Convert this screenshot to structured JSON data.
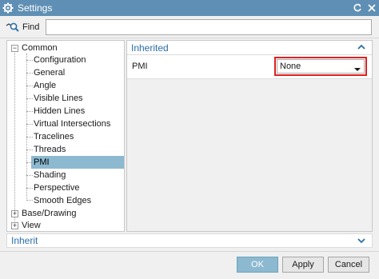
{
  "window": {
    "title": "Settings",
    "title_icon": "gear-icon",
    "accent": "#5f8fb4"
  },
  "find": {
    "label": "Find",
    "value": ""
  },
  "tree": {
    "common": {
      "label": "Common",
      "expanded": true,
      "children": [
        "Configuration",
        "General",
        "Angle",
        "Visible Lines",
        "Hidden Lines",
        "Virtual Intersections",
        "Tracelines",
        "Threads",
        "PMI",
        "Shading",
        "Perspective",
        "Smooth Edges"
      ],
      "selected": "PMI"
    },
    "base_drawing": {
      "label": "Base/Drawing",
      "expanded": false
    },
    "view": {
      "label": "View",
      "expanded": false
    }
  },
  "panel": {
    "section_title": "Inherited",
    "field_label": "PMI",
    "field_value": "None",
    "highlight_color": "#e02020"
  },
  "inherit_bar": {
    "label": "Inherit"
  },
  "buttons": {
    "ok": "OK",
    "apply": "Apply",
    "cancel": "Cancel"
  }
}
